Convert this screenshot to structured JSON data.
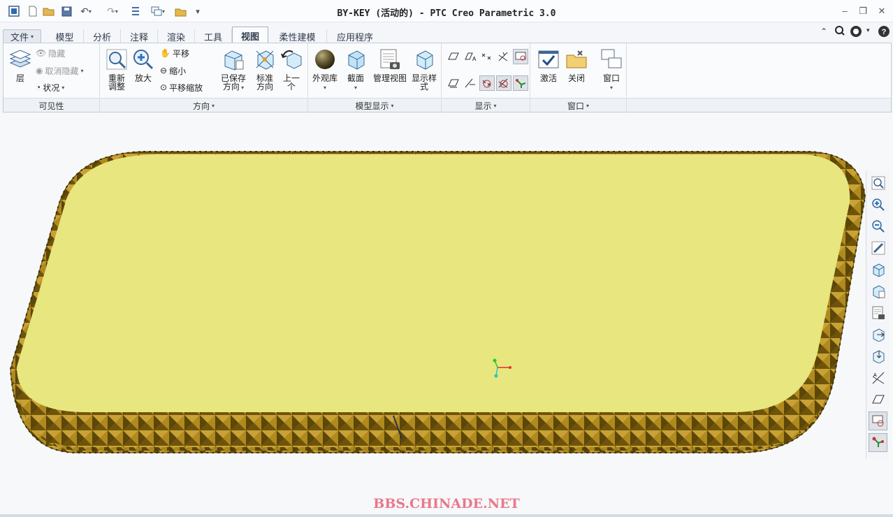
{
  "window": {
    "title": "BY-KEY (活动的) - PTC Creo Parametric 3.0",
    "controls": [
      "minimize-icon",
      "restore-icon",
      "close-icon"
    ]
  },
  "quick_access": [
    "new-icon",
    "open-icon",
    "save-icon",
    "undo-icon",
    "redo-icon",
    "regenerate-icon",
    "windows-icon",
    "close-window-icon",
    "customize-icon"
  ],
  "help_icons": [
    "collapse-ribbon-icon",
    "search-icon",
    "help-center-icon",
    "expand-icon"
  ],
  "tabs": [
    {
      "label": "文件",
      "dropdown": "▾"
    },
    {
      "label": "模型"
    },
    {
      "label": "分析"
    },
    {
      "label": "注释"
    },
    {
      "label": "渲染"
    },
    {
      "label": "工具"
    },
    {
      "label": "视图",
      "active": true
    },
    {
      "label": "柔性建模"
    },
    {
      "label": "应用程序"
    }
  ],
  "ribbon": {
    "visibility": {
      "label": "可见性",
      "layers": "层",
      "hide": "隐藏",
      "unhide": "取消隐藏",
      "status": "状况"
    },
    "orientation": {
      "label": "方向",
      "refit": "重新调整",
      "zoom_in": "放大",
      "pan": "平移",
      "zoom_out": "缩小",
      "pan_zoom": "平移缩放",
      "saved_orientations": "已保存方向",
      "standard_orientation": "标准方向",
      "previous": "上一个"
    },
    "model_display": {
      "label": "模型显示",
      "appearance_gallery": "外观库",
      "section": "截面",
      "manage_views": "管理视图",
      "display_style": "显示样式"
    },
    "show": {
      "label": "显示"
    },
    "window": {
      "label": "窗口",
      "activate": "激活",
      "close": "关闭",
      "windows": "窗口"
    }
  },
  "right_toolbar": [
    "refit-icon",
    "zoom-in-icon",
    "zoom-out-icon",
    "repaint-icon",
    "display-style-icon",
    "saved-orientations-icon",
    "view-manager-icon",
    "spin-center-icon",
    "plane-display-icon",
    "axis-display-icon",
    "point-display-icon",
    "csys-display-icon",
    "annotation-display-icon"
  ],
  "watermark": "BBS.CHINADE.NET",
  "colors": {
    "model_top": "#e8e67e",
    "model_side": "#8a6a10",
    "ribbon_bg": "#fafbfc",
    "watermark": "#e8798a"
  }
}
